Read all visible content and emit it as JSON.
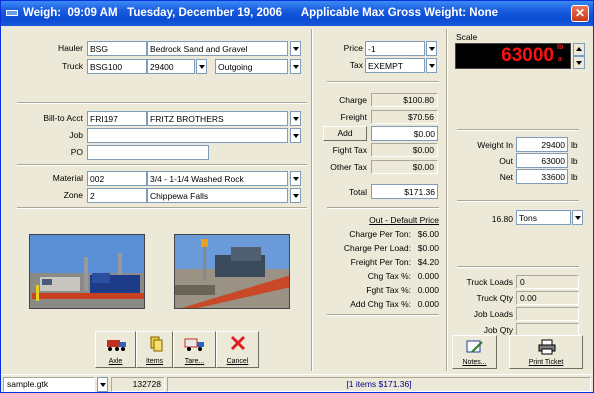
{
  "titlebar": {
    "title": "Weigh:  09:09 AM   Tuesday, December 19, 2006      Applicable Max Gross Weight: None"
  },
  "scale": {
    "label": "Scale",
    "reading": "63000",
    "unit_top": "lb",
    "unit_bottom": "a"
  },
  "hauler": {
    "label": "Hauler",
    "code": "BSG",
    "name": "Bedrock Sand and Gravel"
  },
  "truck": {
    "label": "Truck",
    "code": "BSG100",
    "tare": "29400",
    "direction": "Outgoing"
  },
  "billto": {
    "label": "Bill-to Acct",
    "code": "FRI197",
    "name": "FRITZ BROTHERS"
  },
  "job": {
    "label": "Job",
    "value": ""
  },
  "po": {
    "label": "PO",
    "value": ""
  },
  "material": {
    "label": "Material",
    "code": "002",
    "name": "3/4 - 1-1/4 Washed Rock"
  },
  "zone": {
    "label": "Zone",
    "code": "2",
    "name": "Chippewa Falls"
  },
  "price": {
    "label": "Price",
    "value": "-1"
  },
  "tax": {
    "label": "Tax",
    "value": "EXEMPT"
  },
  "totals": {
    "charge_label": "Charge",
    "charge": "$100.80",
    "freight_label": "Freight",
    "freight": "$70.56",
    "add_label": "Add",
    "add": "$0.00",
    "fight_tax_label": "Fight Tax",
    "fight_tax": "$0.00",
    "other_tax_label": "Other Tax",
    "other_tax": "$0.00",
    "total_label": "Total",
    "total": "$171.36"
  },
  "price_info": {
    "heading": "Out - Default Price",
    "charge_per_ton_label": "Charge Per Ton:",
    "charge_per_ton": "$6.00",
    "charge_per_load_label": "Charge Per Load:",
    "charge_per_load": "$0.00",
    "freight_per_ton_label": "Freight Per Ton:",
    "freight_per_ton": "$4.20",
    "chg_tax_label": "Chg Tax %:",
    "chg_tax": "0.000",
    "fght_tax_label": "Fght Tax %:",
    "fght_tax": "0.000",
    "add_chg_tax_label": "Add Chg Tax %:",
    "add_chg_tax": "0.000"
  },
  "weights": {
    "in_label": "Weight In",
    "in": "29400",
    "in_unit": "lb",
    "out_label": "Out",
    "out": "63000",
    "out_unit": "lb",
    "net_label": "Net",
    "net": "33600",
    "net_unit": "lb"
  },
  "tons": {
    "value": "16.80",
    "unit": "Tons"
  },
  "loads": {
    "truck_loads_label": "Truck Loads",
    "truck_loads": "0",
    "truck_qty_label": "Truck Qty",
    "truck_qty": "0.00",
    "job_loads_label": "Job Loads",
    "job_loads": "",
    "job_qty_label": "Job Qty",
    "job_qty": ""
  },
  "buttons": {
    "axle": "Axle",
    "items": "Items",
    "tare": "Tare...",
    "cancel": "Cancel",
    "notes": "Notes...",
    "print": "Print Ticket"
  },
  "statusbar": {
    "file": "sample.gtk",
    "id": "132728",
    "items": "[1 items  $171.36]"
  }
}
